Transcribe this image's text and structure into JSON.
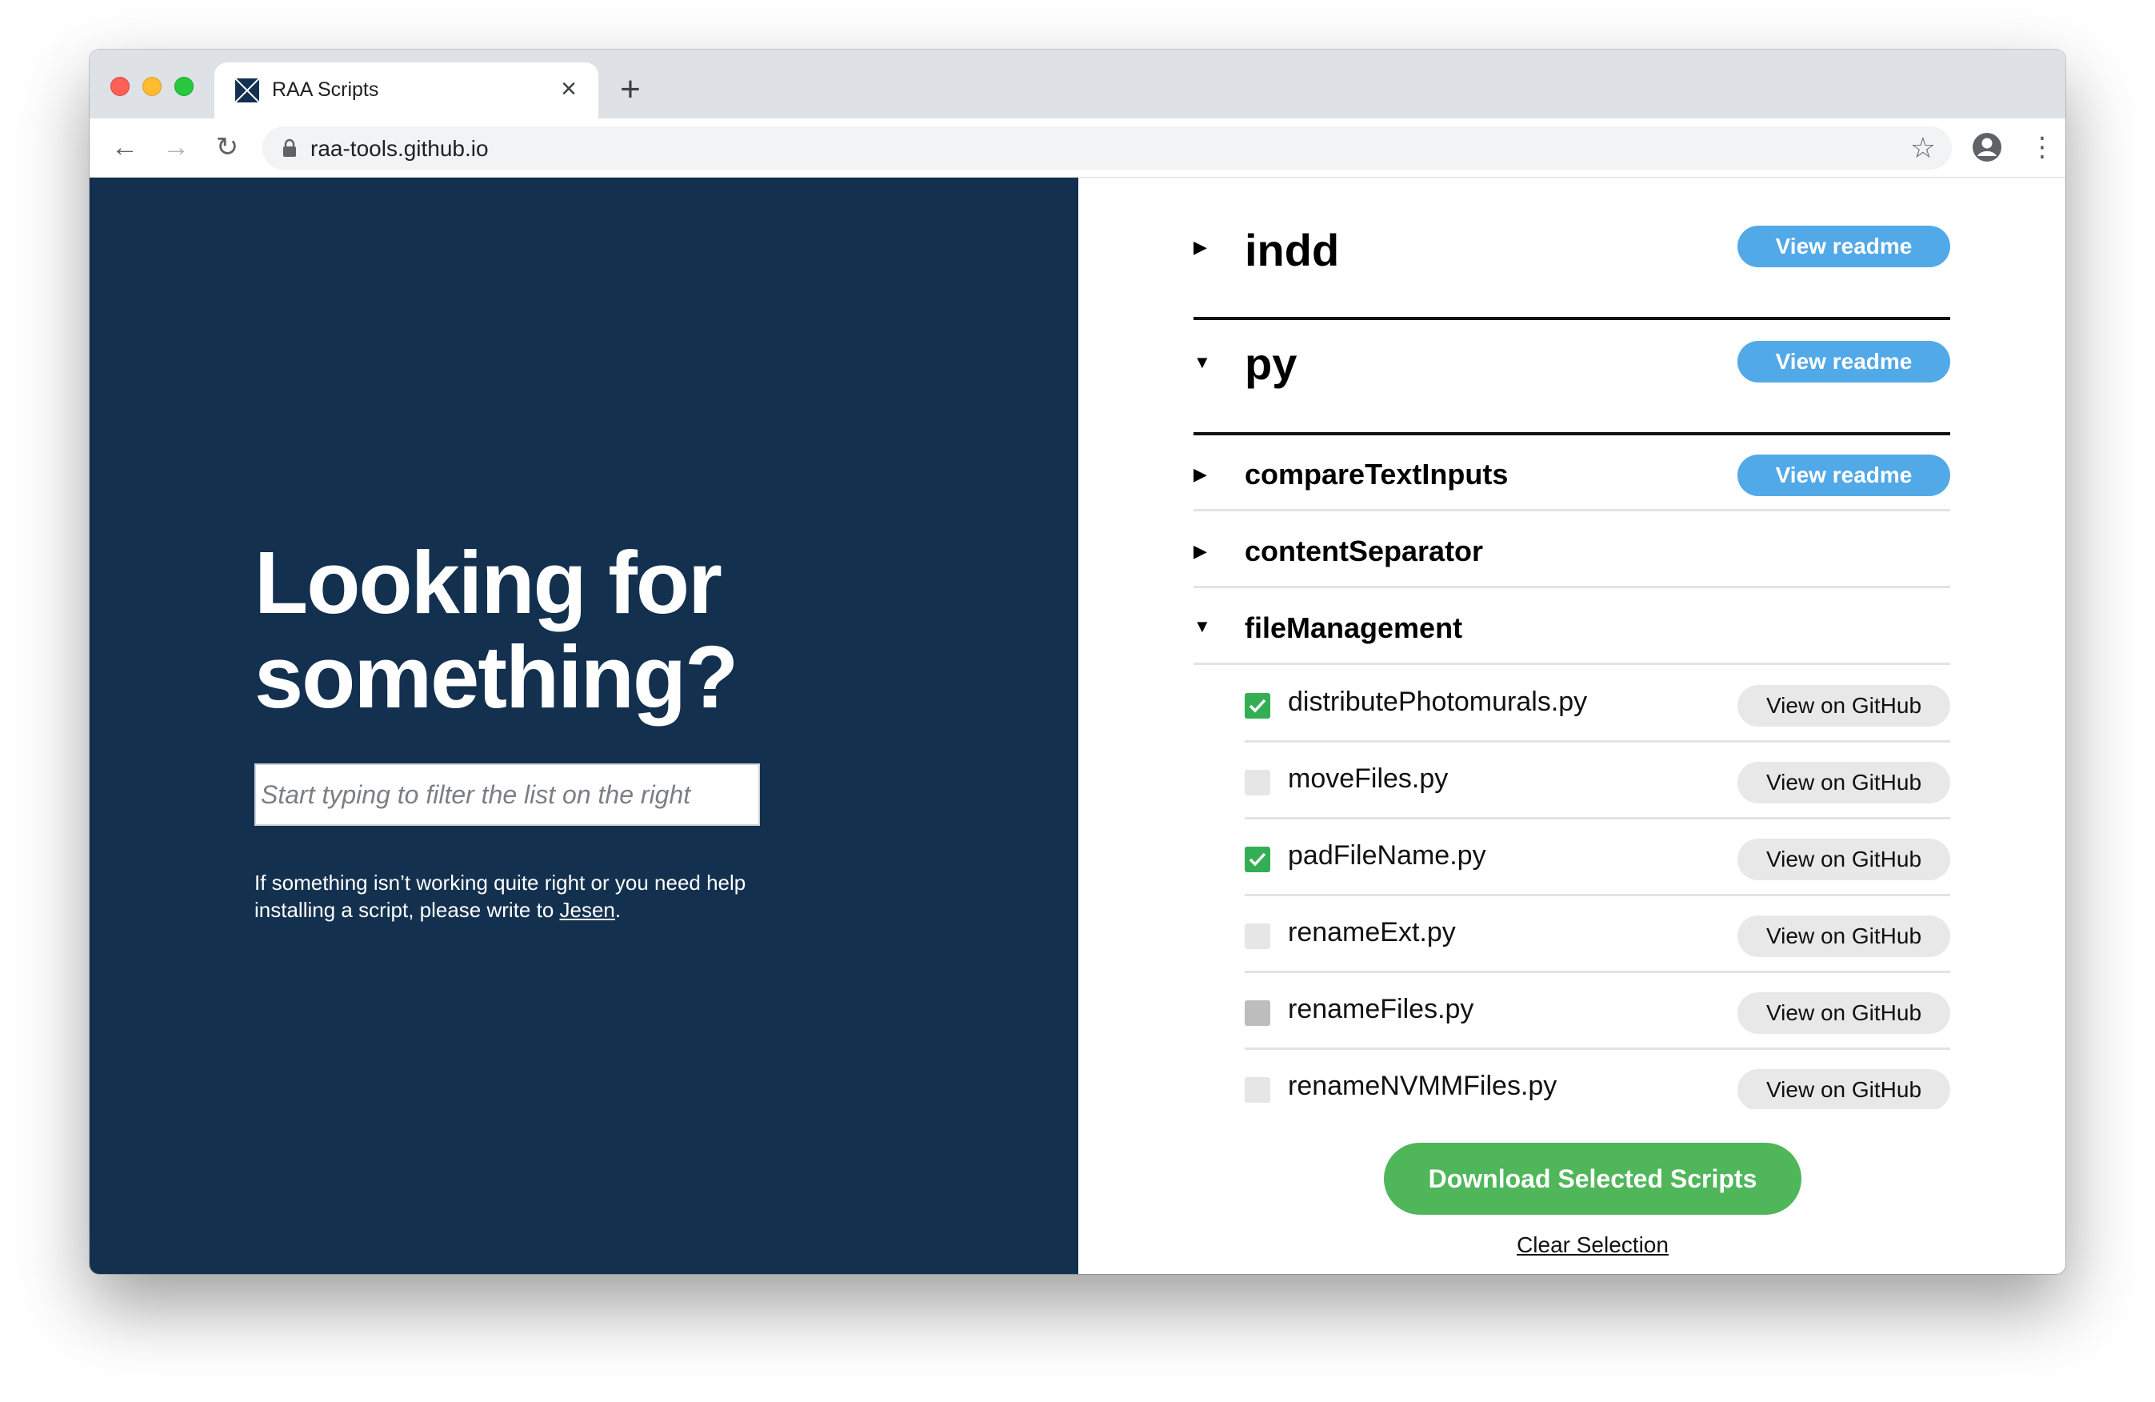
{
  "browser": {
    "tab_title": "RAA Scripts",
    "tab_close_icon": "close-icon",
    "new_tab_icon": "plus-icon",
    "url": "raa-tools.github.io"
  },
  "left": {
    "heading_line1": "Looking for",
    "heading_line2": "something?",
    "filter_placeholder": "Start typing to filter the list on the right",
    "filter_value": "",
    "help_text_before": "If something isn’t working quite right or you need help installing a script, please write to ",
    "help_link": "Jesen",
    "help_text_after": "."
  },
  "right": {
    "sections": [
      {
        "name": "indd",
        "expanded": false,
        "button": "View readme"
      },
      {
        "name": "py",
        "expanded": true,
        "button": "View readme"
      }
    ],
    "subsections": [
      {
        "name": "compareTextInputs",
        "expanded": false,
        "button": "View readme"
      },
      {
        "name": "contentSeparator",
        "expanded": false
      },
      {
        "name": "fileManagement",
        "expanded": true
      }
    ],
    "files": [
      {
        "name": "distributePhotomurals.py",
        "checked": true,
        "button": "View on GitHub"
      },
      {
        "name": "moveFiles.py",
        "checked": false,
        "button": "View on GitHub"
      },
      {
        "name": "padFileName.py",
        "checked": true,
        "button": "View on GitHub"
      },
      {
        "name": "renameExt.py",
        "checked": false,
        "button": "View on GitHub"
      },
      {
        "name": "renameFiles.py",
        "checked": false,
        "button": "View on GitHub"
      },
      {
        "name": "renameNVMMFiles.py",
        "checked": false,
        "button": "View on GitHub"
      }
    ],
    "download_label": "Download Selected Scripts",
    "clear_label": "Clear Selection"
  },
  "colors": {
    "left_bg": "#13304f",
    "readme_button": "#52a9e8",
    "download_button": "#4fb65a",
    "checked": "#34ae54"
  }
}
